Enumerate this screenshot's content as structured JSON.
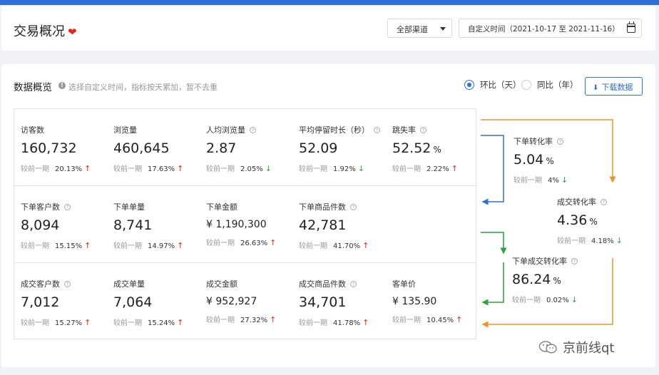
{
  "header": {
    "title": "交易概况",
    "channel_select": "全部渠道",
    "date_range": "自定义时间（2021-10-17 至 2021-11-16）"
  },
  "overview": {
    "title": "数据概览",
    "hint": "选择自定义时间，指标按天累加，暂不去重",
    "radio_mom": "环比（天）",
    "radio_yoy": "同比（年）",
    "download": "下载数据",
    "compare_label": "较前一期"
  },
  "metrics": [
    {
      "label": "访客数",
      "value": "160,732",
      "pct": "20.13%",
      "trend": "up",
      "help": false
    },
    {
      "label": "浏览量",
      "value": "460,645",
      "pct": "17.63%",
      "trend": "up",
      "help": false
    },
    {
      "label": "人均浏览量",
      "value": "2.87",
      "pct": "2.05%",
      "trend": "down",
      "help": true
    },
    {
      "label": "平均停留时长（秒）",
      "value": "52.09",
      "pct": "1.92%",
      "trend": "down",
      "help": true
    },
    {
      "label": "跳失率",
      "value": "52.52",
      "unit": "%",
      "pct": "2.22%",
      "trend": "up",
      "help": true
    },
    {
      "label": "下单客户数",
      "value": "8,094",
      "pct": "15.15%",
      "trend": "up",
      "help": true
    },
    {
      "label": "下单单量",
      "value": "8,741",
      "pct": "14.97%",
      "trend": "up",
      "help": false
    },
    {
      "label": "下单金额",
      "value": "¥ 1,190,300",
      "pct": "26.63%",
      "trend": "up",
      "help": false
    },
    {
      "label": "下单商品件数",
      "value": "42,781",
      "pct": "41.70%",
      "trend": "up",
      "help": true
    },
    {
      "label": "成交客户数",
      "value": "7,012",
      "pct": "15.27%",
      "trend": "up",
      "help": true
    },
    {
      "label": "成交单量",
      "value": "7,064",
      "pct": "15.24%",
      "trend": "up",
      "help": false
    },
    {
      "label": "成交金额",
      "value": "¥ 952,927",
      "pct": "27.32%",
      "trend": "up",
      "help": false
    },
    {
      "label": "成交商品件数",
      "value": "34,701",
      "pct": "41.78%",
      "trend": "up",
      "help": true
    },
    {
      "label": "客单价",
      "value": "¥ 135.90",
      "pct": "10.45%",
      "trend": "up",
      "help": false
    }
  ],
  "conversions": [
    {
      "label": "下单转化率",
      "value": "5.04",
      "unit": "%",
      "pct": "4%",
      "trend": "down",
      "help": true
    },
    {
      "label": "成交转化率",
      "value": "4.36",
      "unit": "%",
      "pct": "4.18%",
      "trend": "down",
      "help": true
    },
    {
      "label": "下单成交转化率",
      "value": "86.24",
      "unit": "%",
      "pct": "0.02%",
      "trend": "down",
      "help": true
    }
  ],
  "colors": {
    "accent": "#2f6fd8",
    "up": "#e5271c",
    "down": "#2aa33a",
    "flow_orange": "#f0932b",
    "flow_blue": "#2f6fd8",
    "flow_green": "#2aa33a"
  },
  "watermark": "京前线qt"
}
